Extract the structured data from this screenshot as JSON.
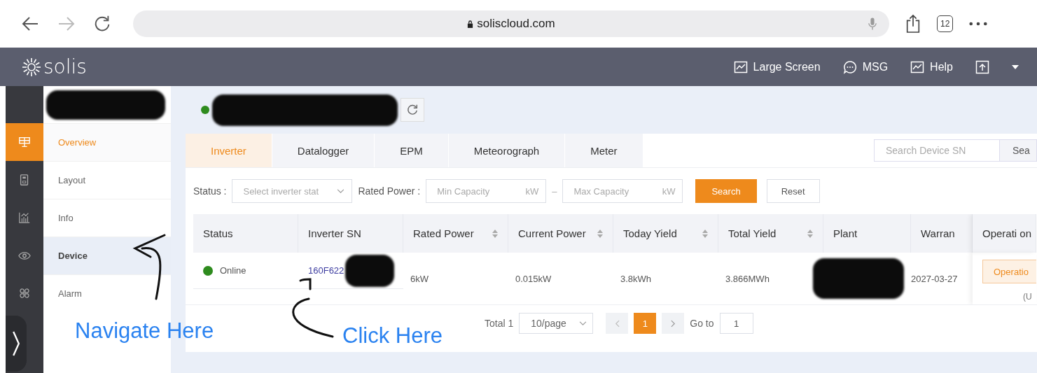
{
  "browser": {
    "url": "soliscloud.com",
    "tab_count": "12"
  },
  "header": {
    "logo": "solis",
    "nav": [
      {
        "kind": "chart",
        "label": "Large Screen"
      },
      {
        "kind": "chat",
        "label": "MSG"
      },
      {
        "kind": "chart",
        "label": "Help"
      },
      {
        "kind": "upload"
      }
    ]
  },
  "rail": [
    {
      "kind": "solar",
      "selected": true
    },
    {
      "kind": "device",
      "selected": false
    },
    {
      "kind": "chart",
      "selected": false
    },
    {
      "kind": "eye",
      "selected": false
    },
    {
      "kind": "grid",
      "selected": false
    }
  ],
  "menu": [
    {
      "label": "Overview",
      "selected": true,
      "hover": false
    },
    {
      "label": "Layout",
      "selected": false,
      "hover": false
    },
    {
      "label": "Info",
      "selected": false,
      "hover": false
    },
    {
      "label": "Device",
      "selected": false,
      "hover": true
    },
    {
      "label": "Alarm",
      "selected": false,
      "hover": false
    }
  ],
  "tabs": [
    {
      "label": "Inverter",
      "selected": true
    },
    {
      "label": "Datalogger",
      "selected": false
    },
    {
      "label": "EPM",
      "selected": false
    },
    {
      "label": "Meteorograph",
      "selected": false
    },
    {
      "label": "Meter",
      "selected": false
    }
  ],
  "device_search": {
    "placeholder": "Search Device SN",
    "button": "Sea"
  },
  "filters": {
    "status_label": "Status :",
    "status_placeholder": "Select inverter stat",
    "power_label": "Rated Power :",
    "min_placeholder": "Min Capacity",
    "max_placeholder": "Max Capacity",
    "min_unit": "kW",
    "max_unit": "kW",
    "range_sep": "–",
    "search": "Search",
    "reset": "Reset"
  },
  "table": {
    "columns": [
      {
        "label": "Status",
        "sortable": false
      },
      {
        "label": "Inverter SN",
        "sortable": false
      },
      {
        "label": "Rated Power",
        "sortable": true
      },
      {
        "label": "Current Power",
        "sortable": true
      },
      {
        "label": "Today Yield",
        "sortable": true
      },
      {
        "label": "Total Yield",
        "sortable": true
      },
      {
        "label": "Plant",
        "sortable": false
      },
      {
        "label": "Warran",
        "sortable": false
      },
      {
        "label": "Operati on",
        "sortable": false
      }
    ],
    "rows": [
      {
        "status": "Online",
        "color": "#2e8b1e",
        "sn": "160F622",
        "rated": "6kW",
        "current": "0.015kW",
        "today": "3.8kWh",
        "total": "3.866MWh",
        "warranty": "2027-03-27",
        "operation": "Operatio",
        "extra": "(U"
      }
    ]
  },
  "pagination": {
    "total": "Total 1",
    "page_size": "10/page",
    "pages": [
      {
        "label": "1",
        "selected": true
      }
    ],
    "goto_label": "Go to",
    "goto_value": "1"
  },
  "annotations": [
    {
      "text": "Navigate Here"
    },
    {
      "text": "Click Here"
    }
  ]
}
